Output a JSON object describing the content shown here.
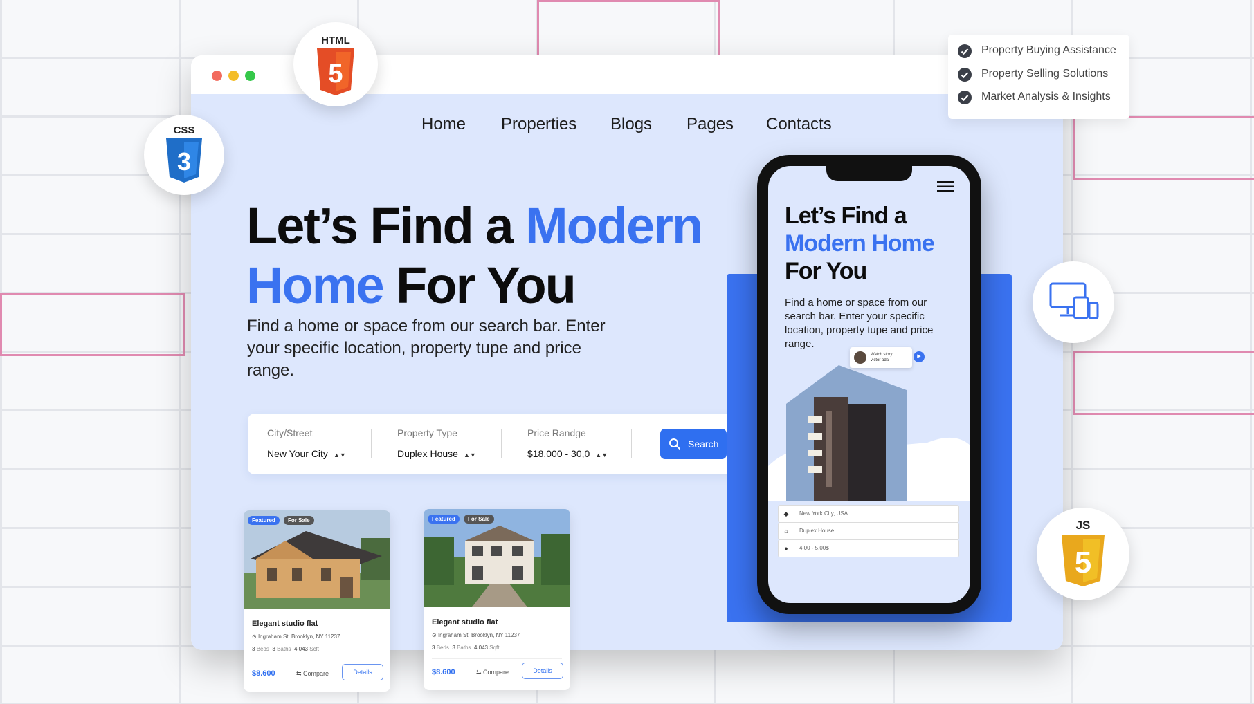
{
  "nav": {
    "items": [
      "Home",
      "Properties",
      "Blogs",
      "Pages",
      "Contacts"
    ]
  },
  "hero": {
    "title_part1": "Let’s Find a ",
    "title_highlight1": "Modern",
    "title_highlight2": "Home",
    "title_part2": " For You",
    "description": "Find a home or space from our search bar. Enter your specific location, property tupe and price range."
  },
  "search": {
    "fields": [
      {
        "label": "City/Street",
        "value": "New Your City"
      },
      {
        "label": "Property Type",
        "value": "Duplex House"
      },
      {
        "label": "Price Randge",
        "value": "$18,000 - 30,0"
      }
    ],
    "button_label": "Search"
  },
  "cards": [
    {
      "badge_featured": "Featured",
      "badge_sale": "For Sale",
      "title": "Elegant studio flat",
      "address": "Ingraham St, Brooklyn, NY 11237",
      "beds": "3",
      "beds_label": "Beds",
      "baths": "3",
      "baths_label": "Baths",
      "area": "4,043",
      "area_unit": "Scft",
      "price": "$8.600",
      "compare": "Compare",
      "details": "Details"
    },
    {
      "badge_featured": "Featured",
      "badge_sale": "For Sale",
      "title": "Elegant studio flat",
      "address": "Ingraham St, Brooklyn, NY 11237",
      "beds": "3",
      "beds_label": "Beds",
      "baths": "3",
      "baths_label": "Baths",
      "area": "4,043",
      "area_unit": "Sqft",
      "price": "$8.600",
      "compare": "Compare",
      "details": "Details"
    }
  ],
  "phone": {
    "title_line1": "Let’s Find a",
    "title_line2": "Modern Home",
    "title_line3": "For You",
    "description": "Find a home or space from our search bar. Enter your specific location, property tupe and price range.",
    "story_line1": "Watch story",
    "story_line2": "victor ada",
    "fields": [
      "New York City, USA",
      "Duplex House",
      "4,00 - 5,00$"
    ]
  },
  "badges": {
    "html": "HTML",
    "css": "CSS",
    "js": "JS",
    "html_num": "5",
    "css_num": "3",
    "js_num": "5"
  },
  "checklist": [
    "Property Buying Assistance",
    "Property Selling Solutions",
    "Market Analysis & Insights"
  ],
  "colors": {
    "accent": "#3a72f0",
    "background": "#dde7fd",
    "html_orange": "#e44d26",
    "css_blue": "#1f6ec8",
    "js_yellow": "#f1bf26"
  }
}
